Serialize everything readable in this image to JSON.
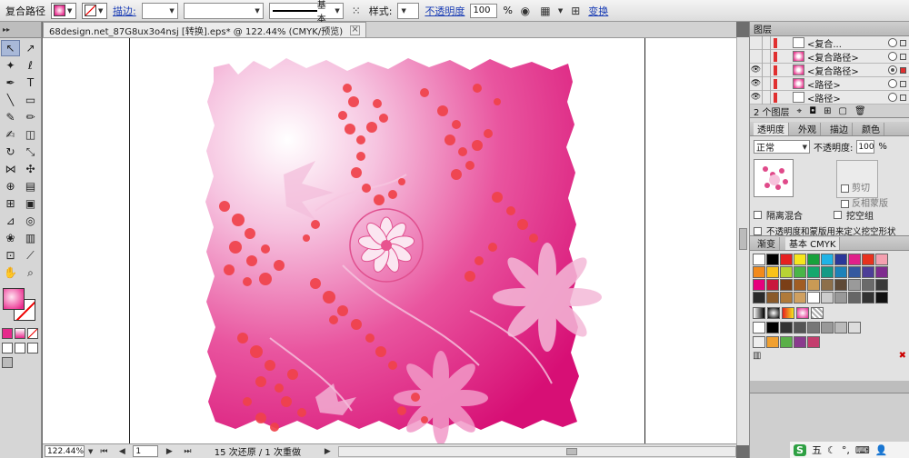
{
  "control_bar": {
    "selection_type": "复合路径",
    "stroke_label": "描边:",
    "stroke_profile": "基本",
    "style_label": "样式:",
    "opacity_label": "不透明度",
    "opacity_value": "100",
    "opacity_unit": "%",
    "transform_label": "变换"
  },
  "document": {
    "tab_title": "68design.net_87G8ux3o4nsj [转换].eps* @ 122.44% (CMYK/预览)"
  },
  "status": {
    "zoom": "122.44%",
    "artboard": "1",
    "message": "15 次还原 / 1 次重做"
  },
  "layers_panel": {
    "title": "图层",
    "rows": [
      {
        "name": "<复合...",
        "selected": false
      },
      {
        "name": "<复合路径>",
        "selected": false
      },
      {
        "name": "<复合路径>",
        "selected": true
      },
      {
        "name": "<路径>",
        "selected": false
      },
      {
        "name": "<路径>",
        "selected": false
      }
    ],
    "footer": "2 个图层"
  },
  "transparency_panel": {
    "tabs": [
      "透明度",
      "外观",
      "描边",
      "颜色"
    ],
    "blend_mode": "正常",
    "opacity_label": "不透明度:",
    "opacity_value": "100",
    "opacity_unit": "%",
    "clip_label": "剪切",
    "invert_label": "反相蒙版",
    "isolate_label": "隔离混合",
    "knockout_label": "挖空组",
    "opacity_mask_label": "不透明度和蒙版用来定义挖空形状"
  },
  "swatches_panel": {
    "tabs": [
      "渐变",
      "基本 CMYK"
    ],
    "rows": [
      [
        "#ffffff",
        "#000000",
        "#e62020",
        "#f6e61c",
        "#18a13c",
        "#1fb3e6",
        "#2a3799",
        "#e0208a",
        "#e8321e",
        "#f4a0b0"
      ],
      [
        "#f28a1c",
        "#f9c21a",
        "#b7d334",
        "#49b548",
        "#15a76d",
        "#149a86",
        "#1d82b9",
        "#34589f",
        "#4d3e97",
        "#7e2c8e"
      ],
      [
        "#e6007e",
        "#c9183c",
        "#7b3f17",
        "#a15d23",
        "#c99a55",
        "#8d6f4a",
        "#5e4936",
        "#9a9a9a",
        "#6a6a6a",
        "#3a3a3a"
      ],
      [
        "#2a2a2a",
        "#8a5a2a",
        "#b07a3a",
        "#d0a060",
        "#ffffff",
        "#cccccc",
        "#999999",
        "#666666",
        "#333333",
        "#111111"
      ]
    ]
  },
  "ime": {
    "label": "五"
  }
}
